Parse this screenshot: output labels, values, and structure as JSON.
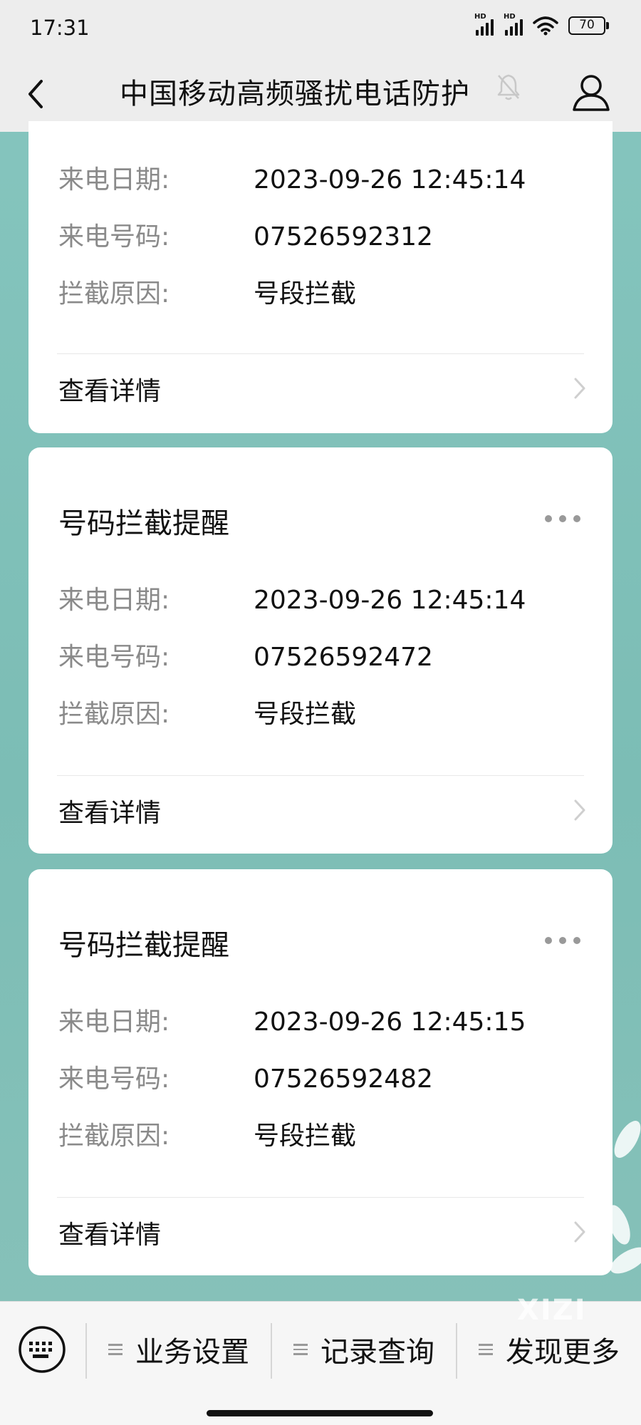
{
  "status_bar": {
    "time": "17:31",
    "hd_label_1": "HD",
    "hd_label_2": "HD",
    "battery": "70"
  },
  "header": {
    "title": "中国移动高频骚扰电话防护"
  },
  "labels": {
    "date": "来电日期:",
    "number": "来电号码:",
    "reason": "拦截原因:",
    "detail": "查看详情"
  },
  "cards": [
    {
      "title": "",
      "date": "2023-09-26 12:45:14",
      "number": "07526592312",
      "reason": "号段拦截"
    },
    {
      "title": "号码拦截提醒",
      "date": "2023-09-26 12:45:14",
      "number": "07526592472",
      "reason": "号段拦截"
    },
    {
      "title": "号码拦截提醒",
      "date": "2023-09-26 12:45:15",
      "number": "07526592482",
      "reason": "号段拦截"
    }
  ],
  "bottom_menu": {
    "items": [
      {
        "label": "业务设置"
      },
      {
        "label": "记录查询"
      },
      {
        "label": "发现更多"
      }
    ]
  },
  "watermark": "XIZI",
  "colors": {
    "background": "#7fbfb7",
    "card": "#ffffff",
    "label_gray": "#8a8a8a"
  }
}
